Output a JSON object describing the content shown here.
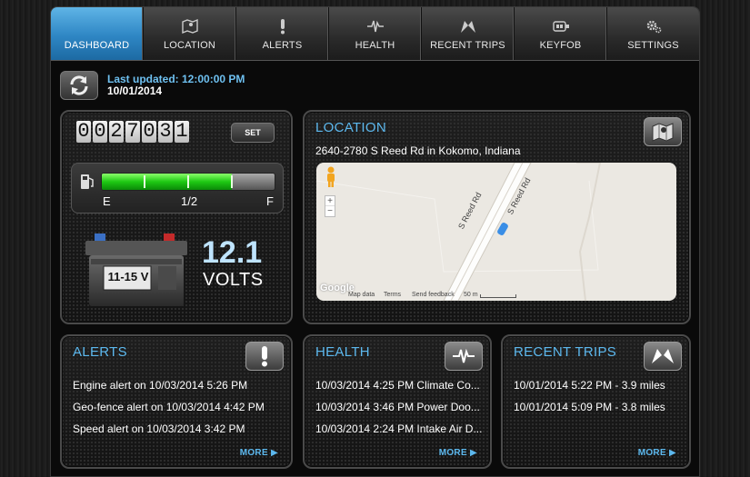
{
  "nav": {
    "tabs": [
      {
        "label": "DASHBOARD",
        "icon": "dashboard",
        "active": true
      },
      {
        "label": "LOCATION",
        "icon": "map-icon"
      },
      {
        "label": "ALERTS",
        "icon": "exclamation-icon"
      },
      {
        "label": "HEALTH",
        "icon": "pulse-icon"
      },
      {
        "label": "RECENT TRIPS",
        "icon": "trips-icon"
      },
      {
        "label": "KEYFOB",
        "icon": "keyfob-icon"
      },
      {
        "label": "SETTINGS",
        "icon": "gear-icon"
      }
    ]
  },
  "status": {
    "last_updated_label": "Last updated: 12:00:00 PM",
    "date": "10/01/2014"
  },
  "vehicle": {
    "odometer": "0027031",
    "set_label": "SET",
    "fuel": {
      "level": 0.75,
      "empty_label": "E",
      "half_label": "1/2",
      "full_label": "F"
    },
    "battery": {
      "range_label": "11-15 V",
      "voltage": "12.1",
      "unit": "VOLTS"
    }
  },
  "location": {
    "title": "LOCATION",
    "address": "2640-2780  S Reed Rd in Kokomo, Indiana",
    "map": {
      "road_label_1": "S Reed Rd",
      "road_label_2": "S Reed Rd",
      "zoom_in": "+",
      "zoom_out": "−",
      "logo": "Google",
      "map_data": "Map data",
      "terms": "Terms",
      "feedback": "Send feedback",
      "scale": "50 m"
    }
  },
  "alerts": {
    "title": "ALERTS",
    "items": [
      "Engine alert on 10/03/2014 5:26 PM",
      "Geo-fence alert on 10/03/2014 4:42 PM",
      "Speed alert on 10/03/2014 3:42 PM"
    ],
    "more": "MORE ▶"
  },
  "health": {
    "title": "HEALTH",
    "items": [
      "10/03/2014 4:25 PM Climate Co...",
      "10/03/2014 3:46 PM Power Doo...",
      "10/03/2014 2:24 PM Intake Air D..."
    ],
    "more": "MORE ▶"
  },
  "trips": {
    "title": "RECENT TRIPS",
    "items": [
      "10/01/2014 5:22 PM - 3.9 miles",
      "10/01/2014 5:09 PM - 3.8 miles"
    ],
    "more": "MORE ▶"
  },
  "colors": {
    "accent": "#5cb8ee",
    "active_tab": "#2e86c4",
    "fuel_green": "#1ec814"
  }
}
